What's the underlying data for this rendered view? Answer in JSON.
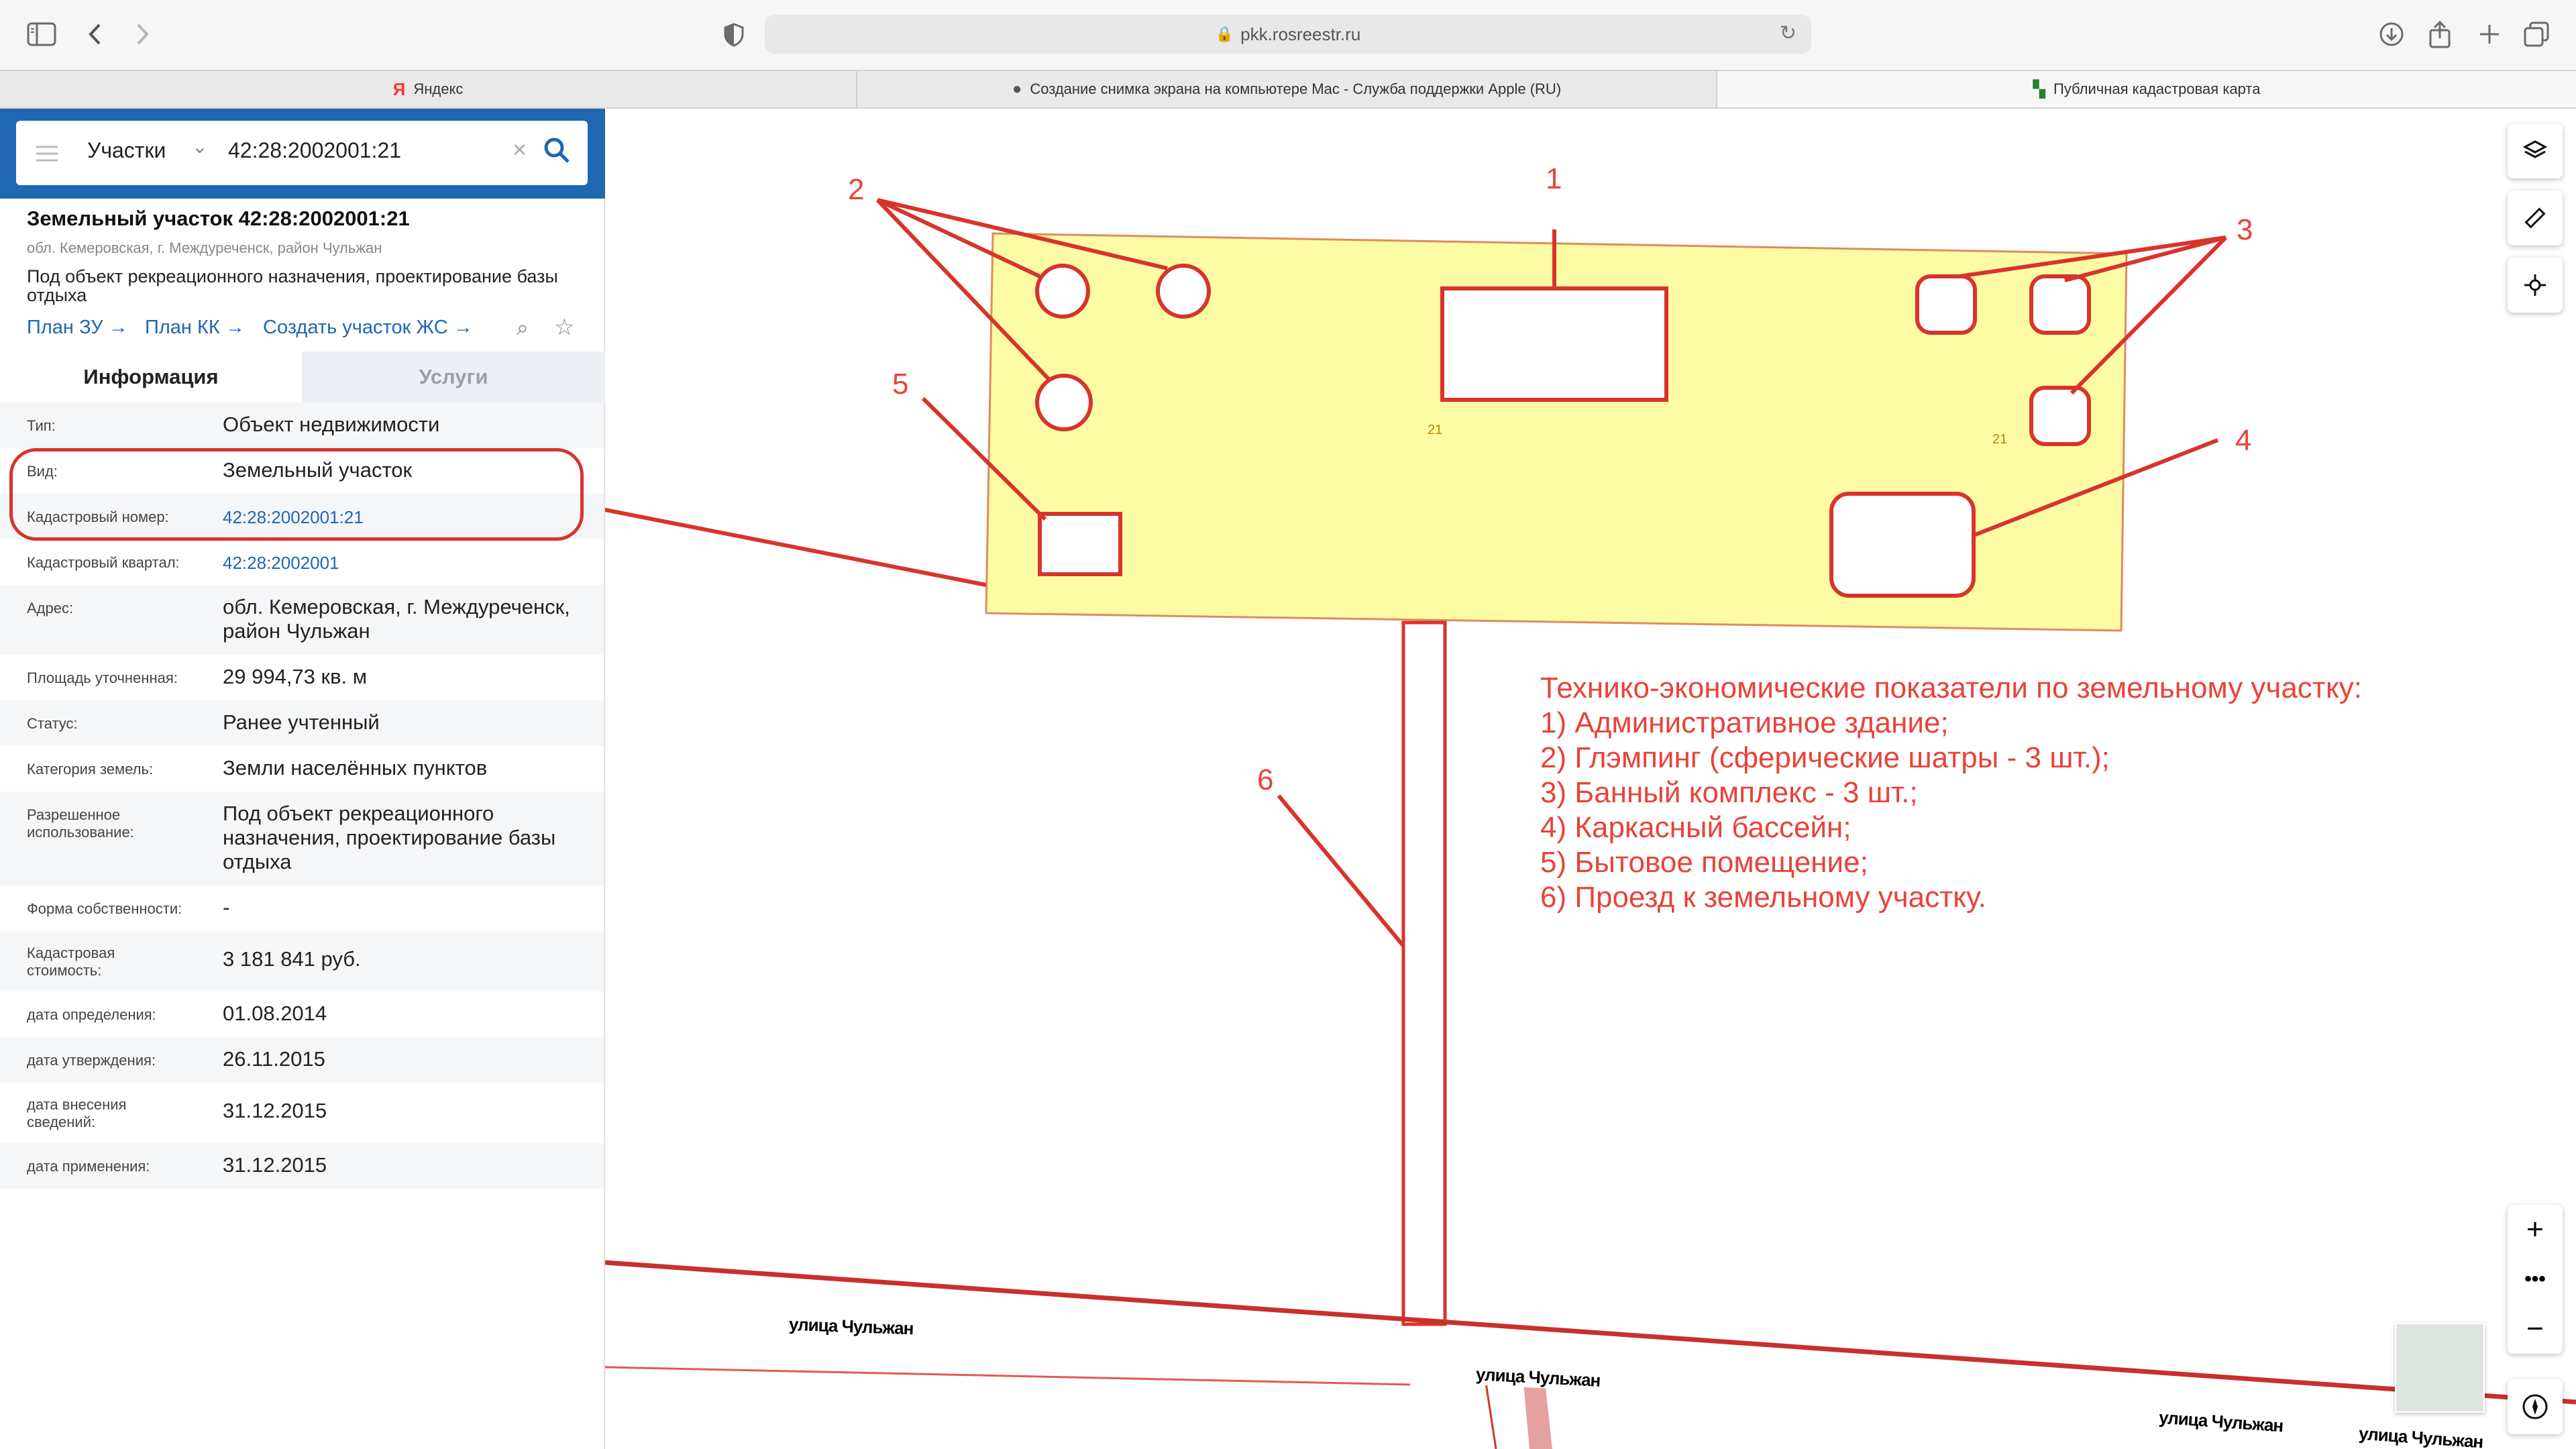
{
  "browser": {
    "url": "pkk.rosreestr.ru",
    "tabs": [
      {
        "label": "Яндекс",
        "icon": "yandex-icon"
      },
      {
        "label": "Создание снимка экрана на компьютере Mac - Служба поддержки Apple (RU)",
        "icon": "apple-icon"
      },
      {
        "label": "Публичная кадастровая карта",
        "icon": "rosreestr-icon"
      }
    ]
  },
  "search": {
    "category": "Участки",
    "query": "42:28:2002001:21"
  },
  "parcel": {
    "title": "Земельный участок 42:28:2002001:21",
    "address_short": "обл. Кемеровская, г. Междуреченск, район Чульжан",
    "purpose": "Под объект рекреационного назначения, проектирование базы отдыха",
    "links": [
      "План ЗУ",
      "План КК",
      "Создать участок ЖС"
    ]
  },
  "tabs": {
    "info": "Информация",
    "services": "Услуги"
  },
  "info_rows": [
    {
      "label": "Тип:",
      "value": "Объект недвижимости"
    },
    {
      "label": "Вид:",
      "value": "Земельный участок"
    },
    {
      "label": "Кадастровый номер:",
      "value": "42:28:2002001:21"
    },
    {
      "label": "Кадастровый квартал:",
      "value": "42:28:2002001"
    },
    {
      "label": "Адрес:",
      "value": "обл. Кемеровская, г. Междуреченск, район Чульжан"
    },
    {
      "label": "Площадь уточненная:",
      "value": "29 994,73 кв. м"
    },
    {
      "label": "Статус:",
      "value": "Ранее учтенный"
    },
    {
      "label": "Категория земель:",
      "value": "Земли населённых пунктов"
    },
    {
      "label": "Разрешенное использование:",
      "value": "Под объект рекреационного назначения, проектирование базы отдыха"
    },
    {
      "label": "Форма собственности:",
      "value": "-"
    },
    {
      "label": "Кадастровая стоимость:",
      "value": "3 181 841 руб."
    },
    {
      "label": "дата определения:",
      "value": "01.08.2014"
    },
    {
      "label": "дата утверждения:",
      "value": "26.11.2015"
    },
    {
      "label": "дата внесения сведений:",
      "value": "31.12.2015"
    },
    {
      "label": "дата применения:",
      "value": "31.12.2015"
    }
  ],
  "map": {
    "parcel_labels": [
      "21",
      "21"
    ],
    "streets": [
      "улица Чульжан",
      "улица Чульжан",
      "улица Чульжан",
      "улица Чульжан"
    ],
    "markers": [
      "1",
      "2",
      "3",
      "4",
      "5",
      "6"
    ],
    "legend": {
      "title": "Технико-экономические показатели по земельному участку:",
      "items": [
        "1) Административное здание;",
        "2) Глэмпинг (сферические шатры - 3 шт.);",
        "3) Банный комплекс - 3 шт.;",
        "4) Каркасный бассейн;",
        "5) Бытовое помещение;",
        "6) Проезд к земельному участку."
      ]
    }
  },
  "colors": {
    "header_blue": "#1f67b1",
    "annotation_red": "#e8433a",
    "parcel_fill": "#fdfca4",
    "road_red": "#c9302c"
  }
}
